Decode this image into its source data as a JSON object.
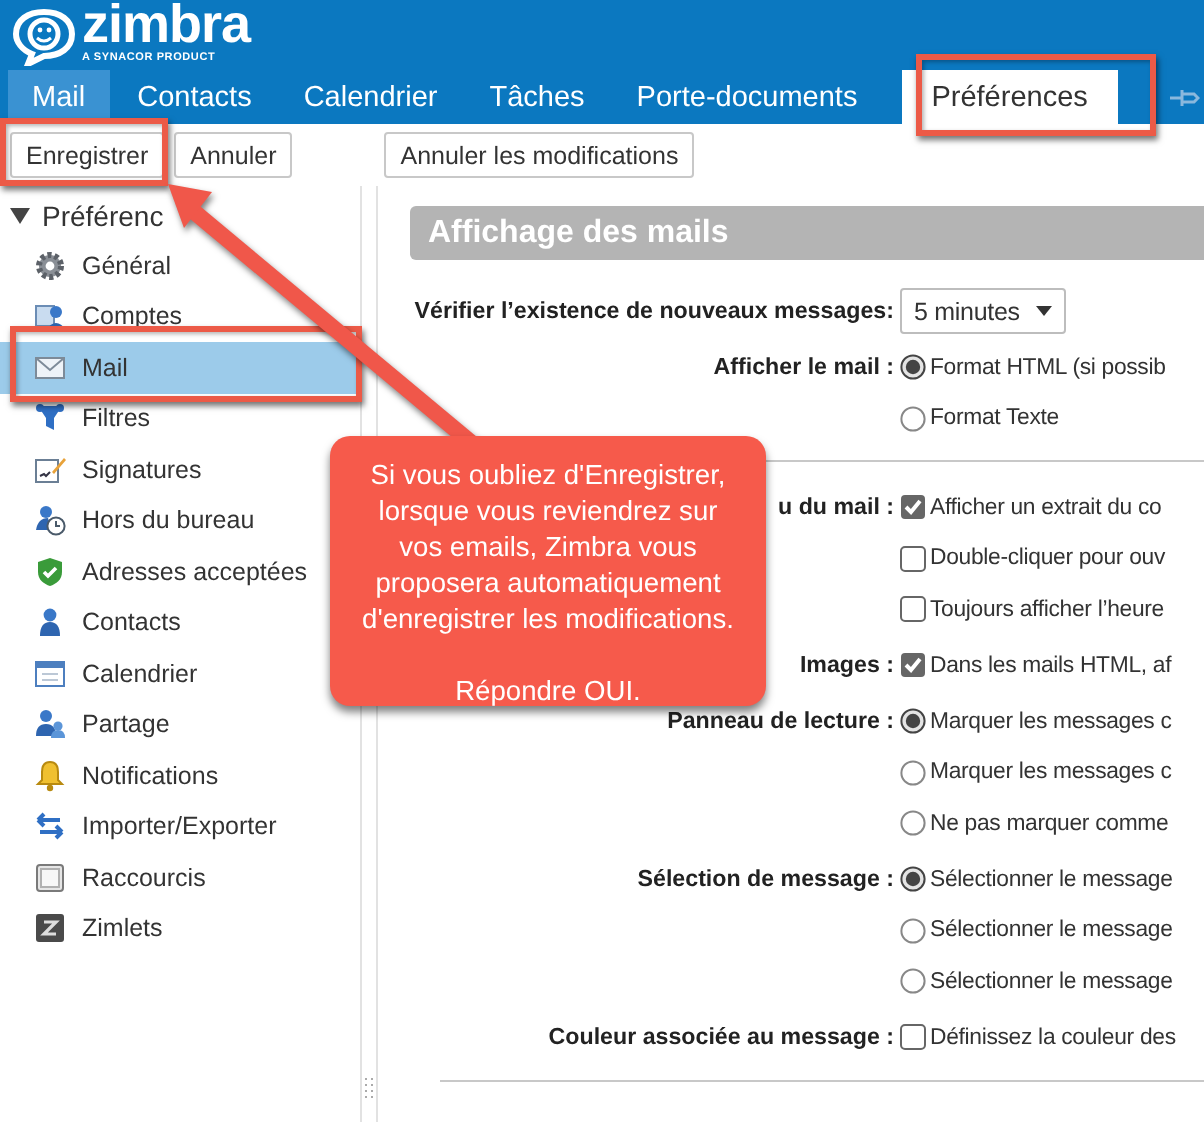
{
  "header": {
    "logo": "zimbra",
    "tagline": "A SYNACOR PRODUCT",
    "tabs": [
      {
        "label": "Mail",
        "selected": false,
        "highlighted": true
      },
      {
        "label": "Contacts",
        "selected": false,
        "highlighted": false
      },
      {
        "label": "Calendrier",
        "selected": false,
        "highlighted": false
      },
      {
        "label": "Tâches",
        "selected": false,
        "highlighted": false
      },
      {
        "label": "Porte-documents",
        "selected": false,
        "highlighted": false
      },
      {
        "label": "Préférences",
        "selected": true,
        "highlighted": false
      }
    ]
  },
  "toolbar": {
    "buttons": [
      "Enregistrer",
      "Annuler"
    ],
    "undo_button": "Annuler les modifications"
  },
  "sidebar": {
    "title": "Préférenc",
    "expanded": true,
    "items": [
      {
        "label": "Général",
        "selected": false
      },
      {
        "label": "Comptes",
        "selected": false
      },
      {
        "label": "Mail",
        "selected": true
      },
      {
        "label": "Filtres",
        "selected": false
      },
      {
        "label": "Signatures",
        "selected": false
      },
      {
        "label": "Hors du bureau",
        "selected": false
      },
      {
        "label": "Adresses acceptées",
        "selected": false
      },
      {
        "label": "Contacts",
        "selected": false
      },
      {
        "label": "Calendrier",
        "selected": false
      },
      {
        "label": "Partage",
        "selected": false
      },
      {
        "label": "Notifications",
        "selected": false
      },
      {
        "label": "Importer/Exporter",
        "selected": false
      },
      {
        "label": "Raccourcis",
        "selected": false
      },
      {
        "label": "Zimlets",
        "selected": false
      }
    ]
  },
  "content": {
    "section_title": "Affichage des mails",
    "blocks": [
      {
        "groups": [
          {
            "label": "Vérifier l’existence de nouveaux messages:",
            "kind": "select",
            "value": "5 minutes"
          },
          {
            "label": "Afficher le mail :",
            "kind": "radio",
            "options": [
              {
                "label": "Format HTML (si possib",
                "selected": true
              },
              {
                "label": "Format Texte",
                "selected": false
              }
            ]
          }
        ]
      },
      {
        "groups": [
          {
            "label": "u du mail :",
            "kind": "checkbox",
            "options": [
              {
                "label": "Afficher un extrait du co",
                "checked": true
              },
              {
                "label": "Double-cliquer pour ouv",
                "checked": false
              },
              {
                "label": "Toujours afficher l’heure",
                "checked": false
              }
            ]
          },
          {
            "label": "Images :",
            "kind": "checkbox",
            "options": [
              {
                "label": "Dans les mails HTML, af",
                "checked": true
              }
            ]
          },
          {
            "label": "Panneau de lecture :",
            "kind": "radio",
            "options": [
              {
                "label": "Marquer les messages c",
                "selected": true
              },
              {
                "label": "Marquer les messages c",
                "selected": false
              },
              {
                "label": "Ne pas marquer comme",
                "selected": false
              }
            ]
          },
          {
            "label": "Sélection de message :",
            "kind": "radio",
            "options": [
              {
                "label": "Sélectionner le message",
                "selected": true
              },
              {
                "label": "Sélectionner le message",
                "selected": false
              },
              {
                "label": "Sélectionner le message",
                "selected": false
              }
            ]
          },
          {
            "label": "Couleur associée au message :",
            "kind": "checkbox",
            "options": [
              {
                "label": "Définissez la couleur des",
                "checked": false
              }
            ]
          }
        ]
      }
    ]
  },
  "annotation": {
    "callout_lines": [
      "Si vous oubliez d'Enregistrer,",
      "lorsque vous reviendrez sur",
      "vos emails, Zimbra vous",
      "proposera automatiquement",
      "d'enregistrer les modifications."
    ],
    "callout_reply": "Répondre OUI."
  }
}
